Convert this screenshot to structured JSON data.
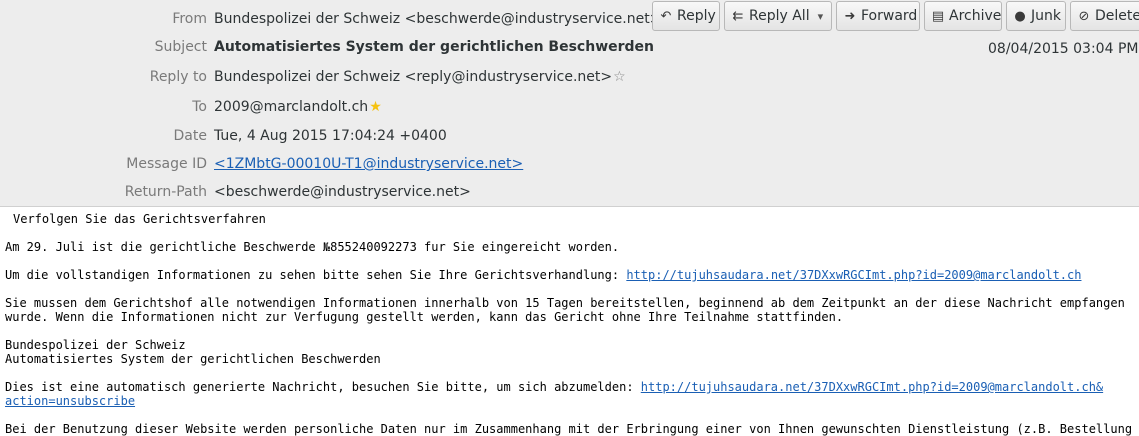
{
  "header": {
    "from_label": "From",
    "from_value": "Bundespolizei der Schweiz <beschwerde@industryservice.net>",
    "subject_label": "Subject",
    "subject_value": "Automatisiertes System der gerichtlichen Beschwerden",
    "replyto_label": "Reply to",
    "replyto_value": "Bundespolizei der Schweiz <reply@industryservice.net>",
    "to_label": "To",
    "to_value": "2009@marclandolt.ch",
    "date_label": "Date",
    "date_value": "Tue, 4 Aug 2015 17:04:24 +0400",
    "msgid_label": "Message ID",
    "msgid_value": "<1ZMbtG-00010U-T1@industryservice.net>",
    "returnpath_label": "Return-Path",
    "returnpath_value": "<beschwerde@industryservice.net>",
    "received_date": "08/04/2015 03:04 PM"
  },
  "toolbar": {
    "reply": "Reply",
    "reply_all": "Reply All",
    "forward": "Forward",
    "archive": "Archive",
    "junk": "Junk",
    "delete": "Delete"
  },
  "body": {
    "l1": "Verfolgen Sie das Gerichtsverfahren",
    "l2": "Am 29. Juli ist die gerichtliche Beschwerde №855240092273 fur Sie eingereicht worden.",
    "l3_text": "Um die vollstandigen Informationen zu sehen bitte sehen Sie Ihre Gerichtsverhandlung: ",
    "l3_link": "http://tujuhsaudara.net/37DXxwRGCImt.php?id=2009@marclandolt.ch",
    "l4": "Sie mussen dem Gerichtshof alle notwendigen Informationen innerhalb von 15 Tagen bereitstellen, beginnend ab dem Zeitpunkt an der diese Nachricht empfangen",
    "l5": "wurde. Wenn die Informationen nicht zur Verfugung gestellt werden, kann das Gericht ohne Ihre Teilnahme stattfinden.",
    "l6": "Bundespolizei der Schweiz",
    "l7": "Automatisiertes System der gerichtlichen Beschwerden",
    "l8_text": "Dies ist eine automatisch generierte Nachricht, besuchen Sie bitte, um sich abzumelden: ",
    "l8_link": "http://tujuhsaudara.net/37DXxwRGCImt.php?id=2009@marclandolt.ch&",
    "l9_link": "action=unsubscribe",
    "l10": "Bei der Benutzung dieser Website werden personliche Daten nur im Zusammenhang mit der Erbringung einer von Ihnen gewunschten Dienstleistung (z.B. Bestellung"
  },
  "icons": {
    "reply": "reply-icon",
    "reply_all": "reply-all-icon",
    "forward": "forward-icon",
    "archive": "archive-icon",
    "junk": "junk-icon",
    "delete": "delete-icon",
    "star": "star-icon"
  },
  "colors": {
    "header_bg": "#ededed",
    "link": "#1a5fb4",
    "star_filled": "#f5c211"
  }
}
